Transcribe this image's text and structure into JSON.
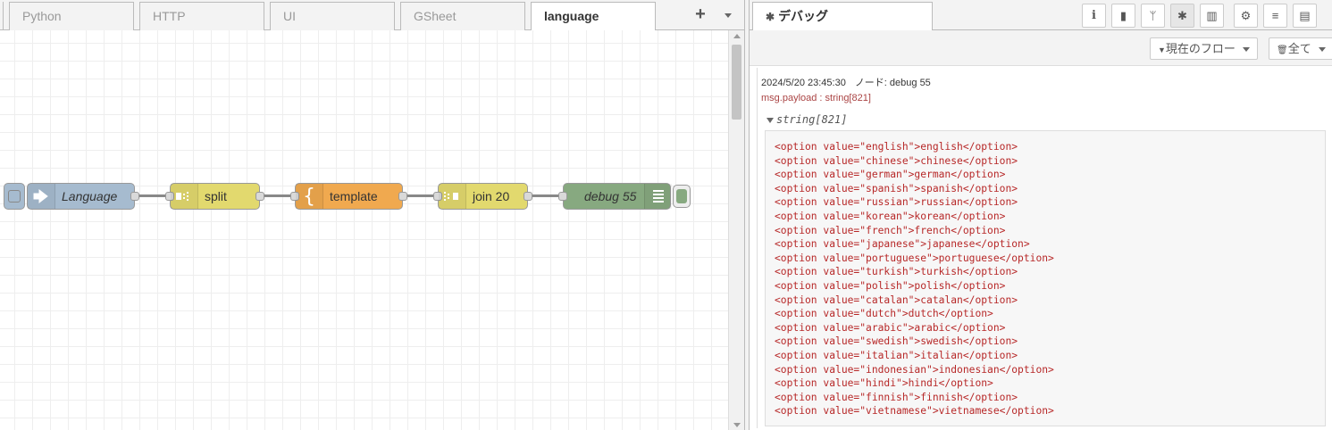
{
  "workspace": {
    "tabs": [
      {
        "label": "Python"
      },
      {
        "label": "HTTP"
      },
      {
        "label": "UI"
      },
      {
        "label": "GSheet"
      },
      {
        "label": "language",
        "active": true
      }
    ],
    "add_tab_label": "+",
    "nodes": [
      {
        "label": "Language",
        "type": "link-in",
        "color": "#a6bbcf"
      },
      {
        "label": "split",
        "type": "split",
        "color": "#e2d96e"
      },
      {
        "label": "template",
        "type": "template",
        "color": "#f0a94f"
      },
      {
        "label": "join 20",
        "type": "join",
        "color": "#e2d96e"
      },
      {
        "label": "debug 55",
        "type": "debug",
        "color": "#87a980"
      }
    ]
  },
  "sidebar": {
    "active_tab_icon": "bug-icon",
    "active_tab_label": "デバッグ",
    "tab_buttons": [
      {
        "icon": "info-icon",
        "glyph": "i"
      },
      {
        "icon": "book-icon",
        "glyph": "▮"
      },
      {
        "icon": "git-branch-icon",
        "glyph": "ᛘ"
      },
      {
        "icon": "bug-icon",
        "glyph": "✱",
        "selected": true
      },
      {
        "icon": "bar-chart-icon",
        "glyph": "▥"
      },
      {
        "icon": "gear-icon",
        "glyph": "⚙"
      },
      {
        "icon": "database-icon",
        "glyph": "≡"
      },
      {
        "icon": "chip-icon",
        "glyph": "▤"
      }
    ],
    "filter_button": {
      "icon": "filter-icon",
      "glyph": "▼",
      "label": "現在のフロー"
    },
    "clear_button": {
      "icon": "trash-icon",
      "glyph": "🗑",
      "label": "全て"
    },
    "message": {
      "timestamp": "2024/5/20 23:45:30",
      "node": "ノード: debug 55",
      "topic": "msg.payload : string[821]",
      "type": "string[821]",
      "lines": [
        "<option value=\"english\">english</option>",
        "<option value=\"chinese\">chinese</option>",
        "<option value=\"german\">german</option>",
        "<option value=\"spanish\">spanish</option>",
        "<option value=\"russian\">russian</option>",
        "<option value=\"korean\">korean</option>",
        "<option value=\"french\">french</option>",
        "<option value=\"japanese\">japanese</option>",
        "<option value=\"portuguese\">portuguese</option>",
        "<option value=\"turkish\">turkish</option>",
        "<option value=\"polish\">polish</option>",
        "<option value=\"catalan\">catalan</option>",
        "<option value=\"dutch\">dutch</option>",
        "<option value=\"arabic\">arabic</option>",
        "<option value=\"swedish\">swedish</option>",
        "<option value=\"italian\">italian</option>",
        "<option value=\"indonesian\">indonesian</option>",
        "<option value=\"hindi\">hindi</option>",
        "<option value=\"finnish\">finnish</option>",
        "<option value=\"vietnamese\">vietnamese</option>"
      ]
    }
  }
}
